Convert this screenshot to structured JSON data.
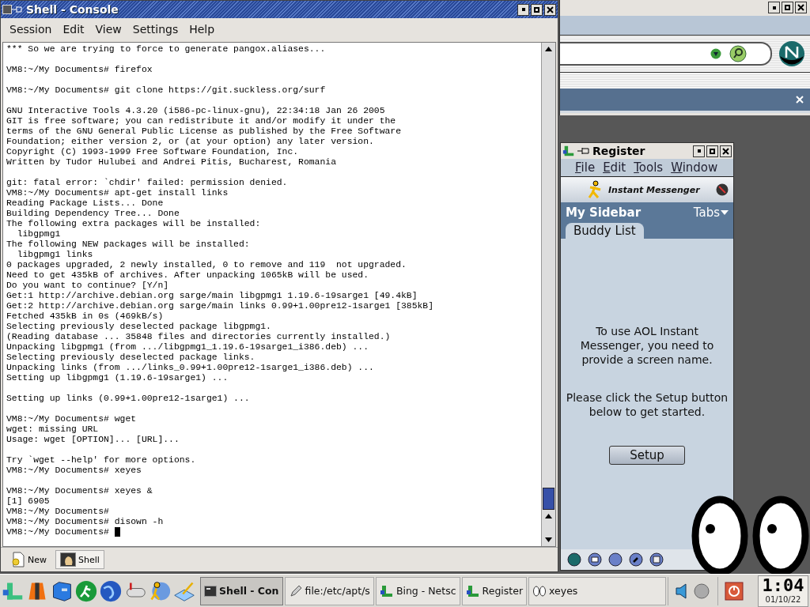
{
  "console": {
    "title": "Shell - Console",
    "menu": [
      "Session",
      "Edit",
      "View",
      "Settings",
      "Help"
    ],
    "terminal": {
      "blocks": [
        [
          "*** So we are trying to force to generate pangox.aliases..."
        ],
        [
          "VM8:~/My Documents# firefox"
        ],
        [
          "VM8:~/My Documents# git clone https://git.suckless.org/surf"
        ],
        [
          "GNU Interactive Tools 4.3.20 (i586-pc-linux-gnu), 22:34:18 Jan 26 2005",
          "GIT is free software; you can redistribute it and/or modify it under the",
          "terms of the GNU General Public License as published by the Free Software",
          "Foundation; either version 2, or (at your option) any later version.",
          "Copyright (C) 1993-1999 Free Software Foundation, Inc.",
          "Written by Tudor Hulubei and Andrei Pitis, Bucharest, Romania"
        ],
        [
          "git: fatal error: `chdir' failed: permission denied.",
          "VM8:~/My Documents# apt-get install links",
          "Reading Package Lists... Done",
          "Building Dependency Tree... Done",
          "The following extra packages will be installed:",
          "  libgpmg1",
          "The following NEW packages will be installed:",
          "  libgpmg1 links",
          "0 packages upgraded, 2 newly installed, 0 to remove and 119  not upgraded.",
          "Need to get 435kB of archives. After unpacking 1065kB will be used.",
          "Do you want to continue? [Y/n]",
          "Get:1 http://archive.debian.org sarge/main libgpmg1 1.19.6-19sarge1 [49.4kB]",
          "Get:2 http://archive.debian.org sarge/main links 0.99+1.00pre12-1sarge1 [385kB]",
          "Fetched 435kB in 0s (469kB/s)",
          "Selecting previously deselected package libgpmg1.",
          "(Reading database ... 35848 files and directories currently installed.)",
          "Unpacking libgpmg1 (from .../libgpmg1_1.19.6-19sarge1_i386.deb) ...",
          "Selecting previously deselected package links.",
          "Unpacking links (from .../links_0.99+1.00pre12-1sarge1_i386.deb) ...",
          "Setting up libgpmg1 (1.19.6-19sarge1) ..."
        ],
        [
          "Setting up links (0.99+1.00pre12-1sarge1) ..."
        ],
        [
          "VM8:~/My Documents# wget",
          "wget: missing URL",
          "Usage: wget [OPTION]... [URL]..."
        ],
        [
          "Try `wget --help' for more options.",
          "VM8:~/My Documents# xeyes"
        ],
        [
          "VM8:~/My Documents# xeyes &",
          "[1] 6905",
          "VM8:~/My Documents#",
          "VM8:~/My Documents# disown -h",
          "VM8:~/My Documents# "
        ]
      ],
      "cursor_visible": true
    },
    "session_tabs": [
      {
        "label": "New",
        "selected": false
      },
      {
        "label": "Shell",
        "selected": true
      }
    ]
  },
  "register": {
    "title": "Register",
    "menu": [
      "File",
      "Edit",
      "Tools",
      "Window"
    ],
    "banner": "Instant Messenger",
    "sidebar_title": "My Sidebar",
    "tabs_menu": "Tabs",
    "panel_tab": "Buddy List",
    "messages": [
      "To use AOL Instant Messenger, you need to provide a screen name.",
      "Please click the Setup button below to get started."
    ],
    "setup_button": "Setup"
  },
  "taskbar": {
    "tasks": [
      {
        "label": "Shell - Con",
        "kind": "terminal",
        "selected": true
      },
      {
        "label": "file:/etc/apt/s",
        "kind": "file",
        "selected": false
      },
      {
        "label": "Bing - Netsc",
        "kind": "browser",
        "selected": false
      },
      {
        "label": "Register",
        "kind": "browser",
        "selected": false
      },
      {
        "label": "xeyes",
        "kind": "eyes",
        "selected": false
      }
    ],
    "clock": {
      "time": "1:04",
      "date": "01/10/22"
    }
  }
}
